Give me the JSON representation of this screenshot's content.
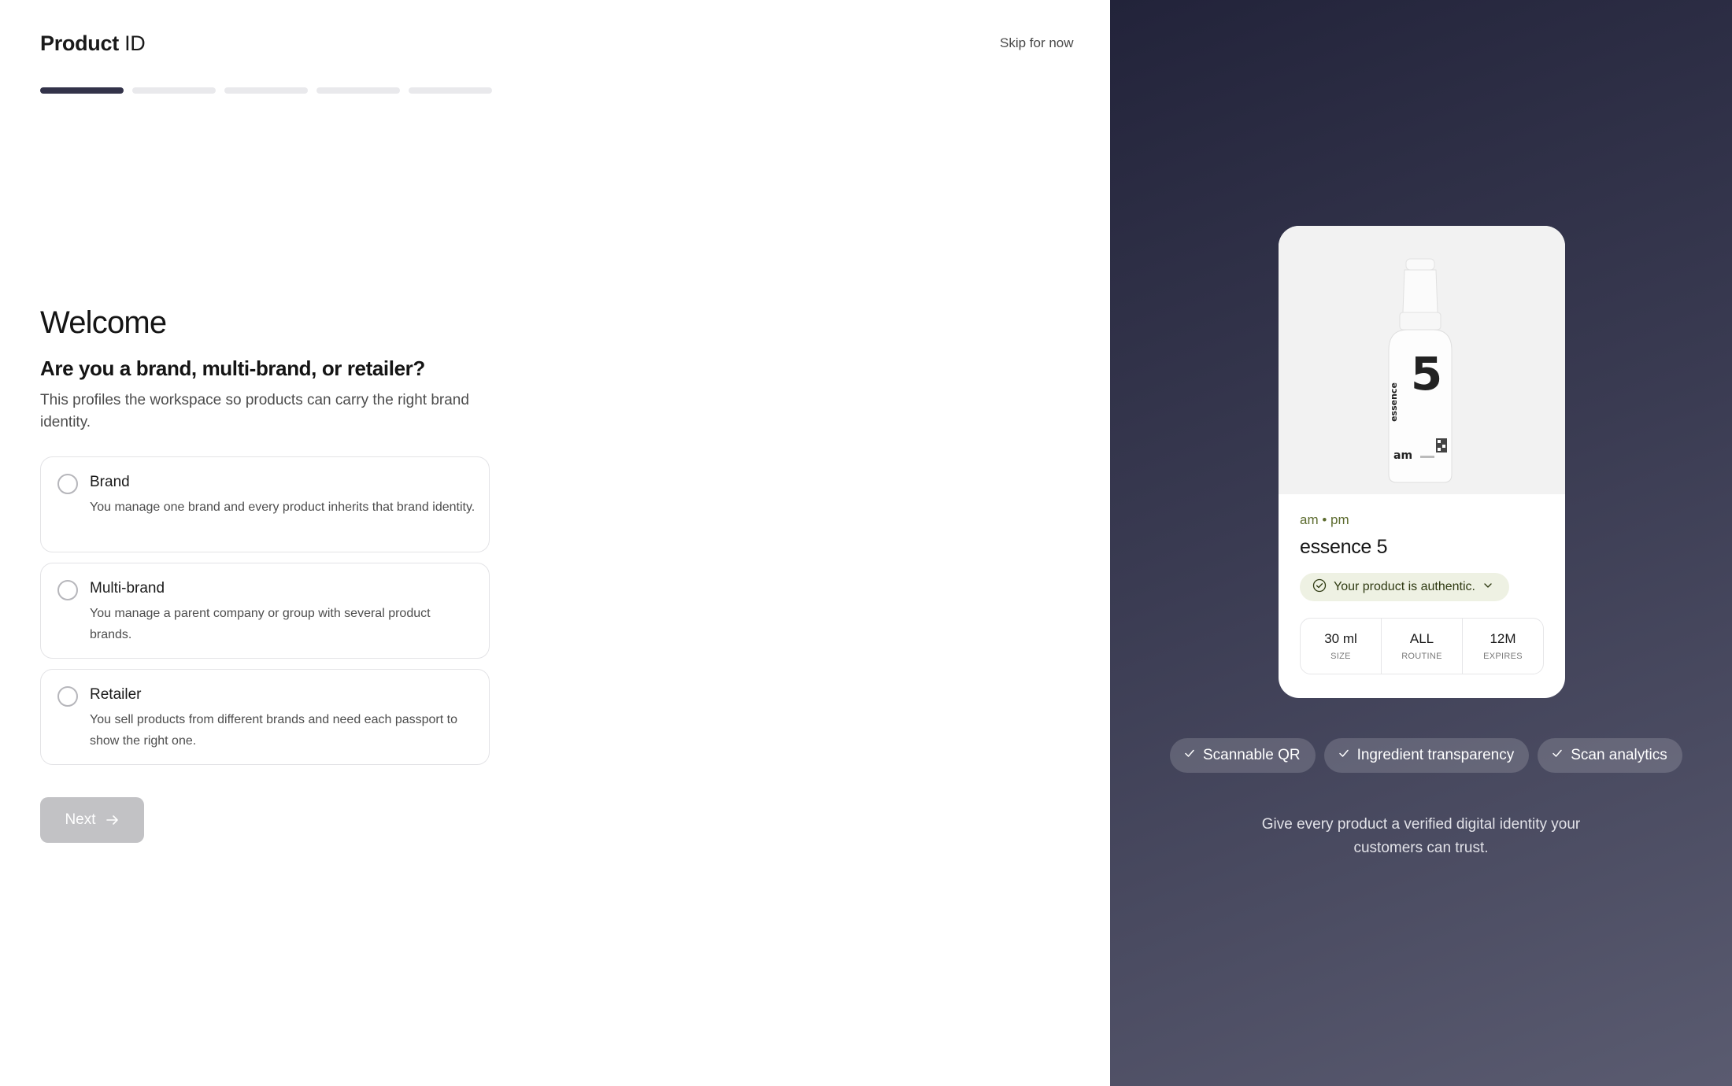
{
  "header": {
    "logo_bold": "Product",
    "logo_light": "ID",
    "skip_label": "Skip for now"
  },
  "progress": {
    "total_steps": 5,
    "current_step": 1
  },
  "main": {
    "heading": "Welcome",
    "question": "Are you a brand, multi-brand, or retailer?",
    "subtitle": "This profiles the workspace so products can carry the right brand identity.",
    "options": [
      {
        "title": "Brand",
        "description": "You manage one brand and every product inherits that brand identity.",
        "selected": false
      },
      {
        "title": "Multi-brand",
        "description": "You manage a parent company or group with several product brands.",
        "selected": false
      },
      {
        "title": "Retailer",
        "description": "You sell products from different brands and need each passport to show the right one.",
        "selected": false
      }
    ],
    "next_label": "Next"
  },
  "preview": {
    "brand_line": "am • pm",
    "product_name": "essence 5",
    "auth_label": "Your product is authentic.",
    "bottle_number": "5",
    "bottle_word": "essence",
    "bottle_logo": "am",
    "stats": [
      {
        "value": "30 ml",
        "label": "SIZE"
      },
      {
        "value": "ALL",
        "label": "ROUTINE"
      },
      {
        "value": "12M",
        "label": "EXPIRES"
      }
    ],
    "features": [
      "Scannable QR",
      "Ingredient transparency",
      "Scan analytics"
    ],
    "tagline": "Give every product a verified digital identity your customers can trust."
  },
  "colors": {
    "accent_dark": "#33334a",
    "panel_gradient_start": "#22233a",
    "panel_gradient_end": "#5a5b70",
    "auth_bg": "#eef1e3",
    "brand_green": "#5c6b2e",
    "next_disabled": "#c2c2c5"
  }
}
